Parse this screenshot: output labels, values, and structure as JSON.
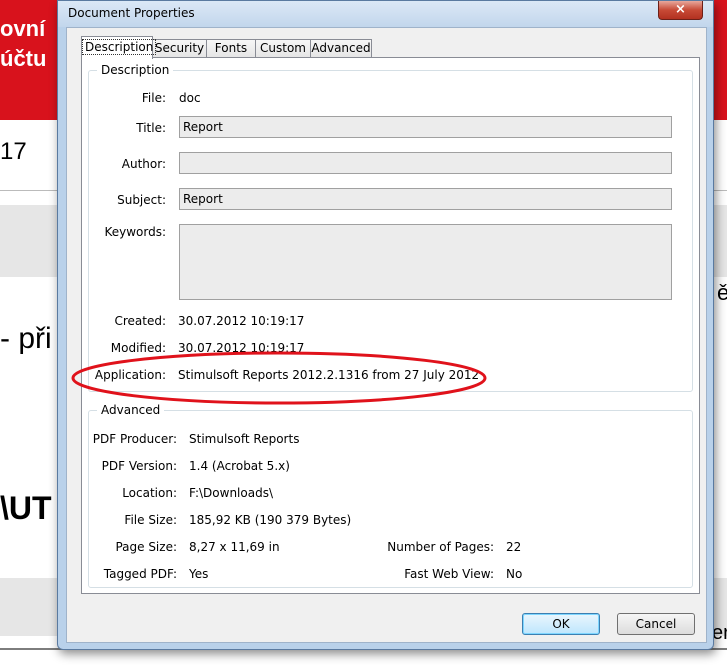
{
  "background": {
    "red_line1": "ovní",
    "red_line2": "účtu",
    "row_number": "17",
    "row_text1": "- při",
    "row_text2": "\\UT",
    "right_edge1": "ě",
    "right_edge2": "er"
  },
  "dialog": {
    "title": "Document Properties",
    "close_label": "×",
    "tabs": [
      "Description",
      "Security",
      "Fonts",
      "Custom",
      "Advanced"
    ],
    "description": {
      "legend": "Description",
      "file_label": "File:",
      "file_value": "doc",
      "title_label": "Title:",
      "title_value": "Report",
      "author_label": "Author:",
      "author_value": "",
      "subject_label": "Subject:",
      "subject_value": "Report",
      "keywords_label": "Keywords:",
      "keywords_value": "",
      "created_label": "Created:",
      "created_value": "30.07.2012 10:19:17",
      "modified_label": "Modified:",
      "modified_value": "30.07.2012 10:19:17",
      "application_label": "Application:",
      "application_value": "Stimulsoft Reports 2012.2.1316 from 27 July 2012"
    },
    "advanced": {
      "legend": "Advanced",
      "producer_label": "PDF Producer:",
      "producer_value": "Stimulsoft Reports",
      "version_label": "PDF Version:",
      "version_value": "1.4 (Acrobat 5.x)",
      "location_label": "Location:",
      "location_value": "F:\\Downloads\\",
      "filesize_label": "File Size:",
      "filesize_value": "185,92 KB (190 379 Bytes)",
      "pagesize_label": "Page Size:",
      "pagesize_value": "8,27 x 11,69 in",
      "pages_label": "Number of Pages:",
      "pages_value": "22",
      "tagged_label": "Tagged PDF:",
      "tagged_value": "Yes",
      "fastweb_label": "Fast Web View:",
      "fastweb_value": "No"
    },
    "ok_label": "OK",
    "cancel_label": "Cancel"
  },
  "colors": {
    "accent_red": "#d8121c",
    "annotation_ellipse": "#e0121b",
    "dialog_frame": "#b9d1ea"
  },
  "icons": [
    "document-icon",
    "close-icon"
  ]
}
